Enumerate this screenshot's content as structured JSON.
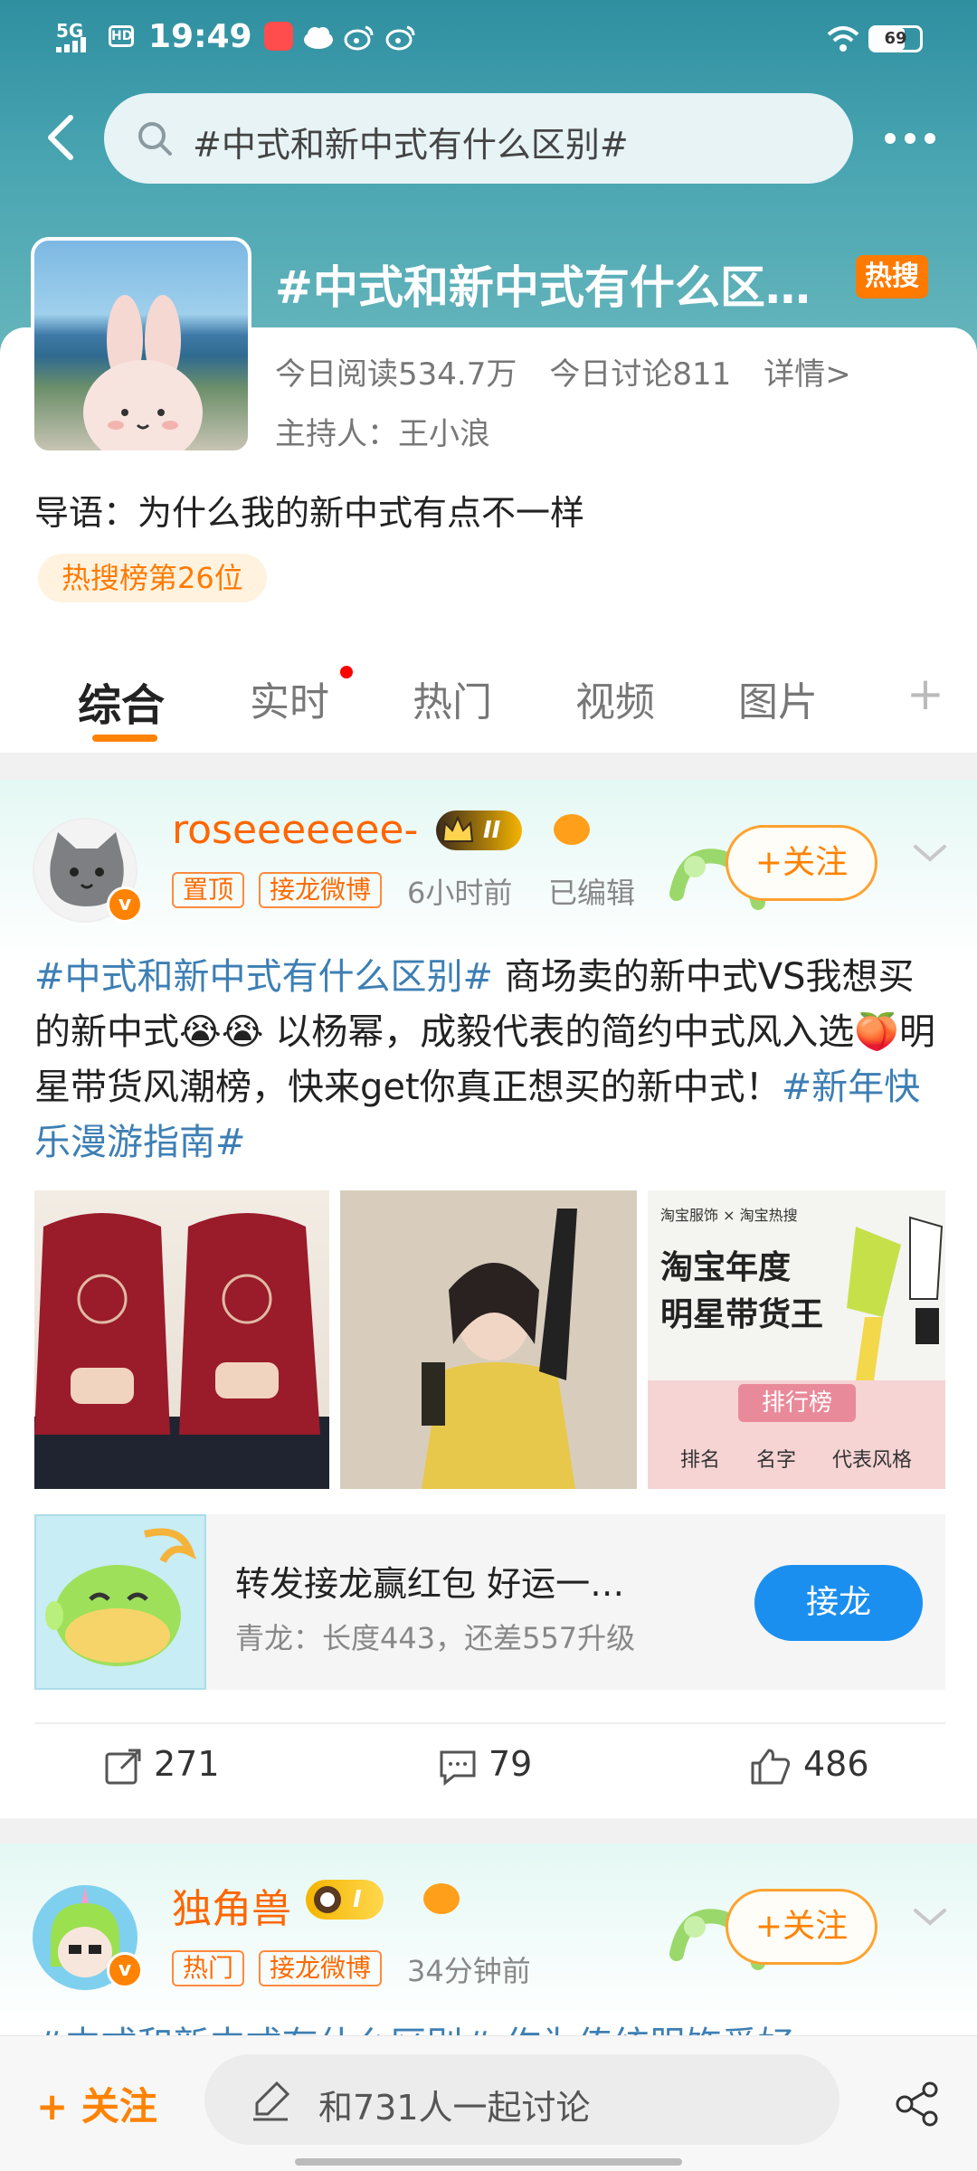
{
  "status_bar": {
    "signal": "5G",
    "hd": "HD",
    "time": "19:49",
    "battery": "69",
    "battery_level": 0.69
  },
  "search": {
    "query": "#中式和新中式有什么区别#"
  },
  "topic": {
    "title": "#中式和新中式有什么区…",
    "hot_badge": "热搜",
    "reads": "今日阅读534.7万",
    "discussions": "今日讨论811",
    "details": "详情>",
    "host": "主持人：王小浪",
    "intro": "导语：为什么我的新中式有点不一样",
    "rank": "热搜榜第26位"
  },
  "tabs": [
    {
      "label": "综合"
    },
    {
      "label": "实时"
    },
    {
      "label": "热门"
    },
    {
      "label": "视频"
    },
    {
      "label": "图片"
    }
  ],
  "posts": [
    {
      "username": "roseeeeeee-",
      "level": "II",
      "tags": [
        "置顶",
        "接龙微博"
      ],
      "time": "6小时前",
      "edited": "已编辑",
      "follow": "+关注",
      "text_parts": {
        "hashtag1": "#中式和新中式有什么区别#",
        "body1": " 商场卖的新中式VS我想买的新中式",
        "emoji1": "😭😭",
        "body2": "  以杨幂，成毅代表的简约中式风入选",
        "emoji2": "🍑",
        "body3": "明星带货风潮榜，快来get你真正想买的新中式！",
        "hashtag2": "#新年快乐漫游指南#"
      },
      "image3_text": {
        "brand": "淘宝服饰 × 淘宝热搜",
        "title_line1": "淘宝年度",
        "title_line2": "明星带货王",
        "ribbon": "排行榜",
        "cols": [
          "排名",
          "名字",
          "代表风格"
        ]
      },
      "jielong": {
        "title": "转发接龙赢红包  好运一…",
        "subtitle": "青龙：长度443，还差557升级",
        "button": "接龙"
      },
      "reposts": "271",
      "comments": "79",
      "likes": "486"
    },
    {
      "username": "独角兽",
      "level": "I",
      "tags": [
        "热门",
        "接龙微博"
      ],
      "time": "34分钟前",
      "follow": "+关注",
      "text_preview": "#中式和新中式有什么区别#  作为传统服饰爱好"
    }
  ],
  "bottom_bar": {
    "follow": "+ 关注",
    "discuss": "和731人一起讨论"
  },
  "colors": {
    "accent": "#ff8200",
    "hashtag": "#3d7fb4",
    "header": "#3f9aa8",
    "button_blue": "#1a8ff0"
  }
}
